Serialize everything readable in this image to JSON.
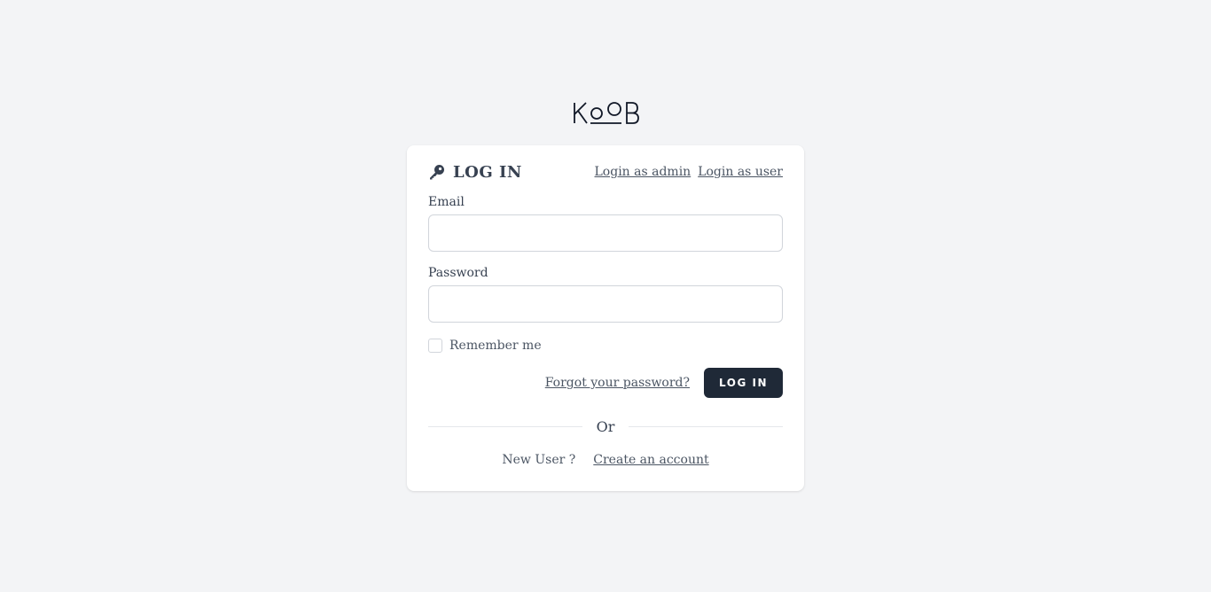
{
  "brand": {
    "logo_text": "KOOB"
  },
  "card": {
    "title": "LOG IN",
    "login_admin_link": "Login as admin",
    "login_user_link": "Login as user"
  },
  "form": {
    "email_label": "Email",
    "email_value": "",
    "password_label": "Password",
    "password_value": "",
    "remember_label": "Remember me",
    "remember_checked": false,
    "forgot_link": "Forgot your password?",
    "submit_label": "Log in"
  },
  "divider": {
    "text": "Or"
  },
  "signup": {
    "prompt": "New User ?",
    "link": "Create an account"
  },
  "colors": {
    "background": "#f3f4f6",
    "card": "#ffffff",
    "primary_button": "#1f2937",
    "text": "#374151"
  },
  "icons": {
    "title_icon": "key-icon",
    "logo": "koob-logo"
  }
}
